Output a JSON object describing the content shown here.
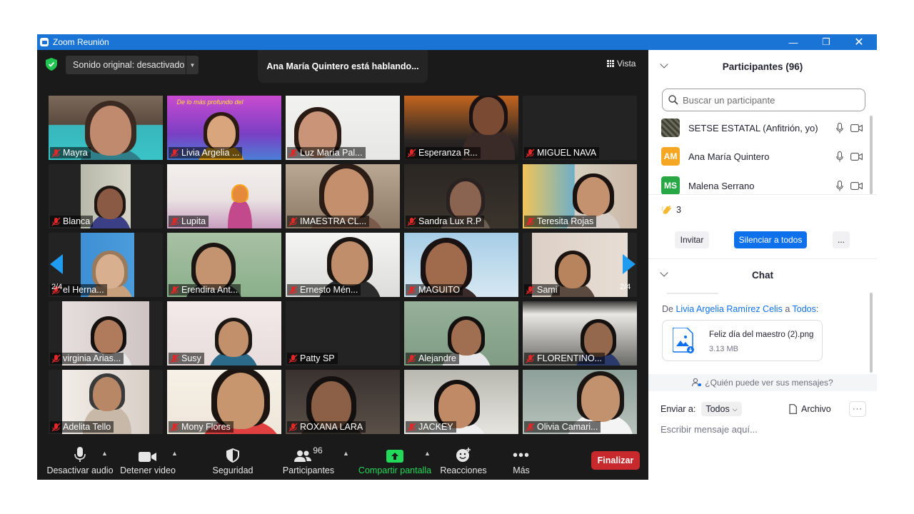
{
  "window": {
    "title": "Zoom Reunión"
  },
  "meeting": {
    "original_sound": "Sonido original: desactivado",
    "speaking": "Ana María Quintero está hablando...",
    "view_label": "Vista",
    "page_left": "2/4",
    "page_right": "2/4",
    "tiles": [
      {
        "name": "Mayra"
      },
      {
        "name": "Livia Argelia ..."
      },
      {
        "name": "Luz María Pal..."
      },
      {
        "name": "Esperanza R..."
      },
      {
        "name": "MIGUEL NAVA"
      },
      {
        "name": "Blanca"
      },
      {
        "name": "Lupita"
      },
      {
        "name": "IMAESTRA CL..."
      },
      {
        "name": "Sandra Lux R.P"
      },
      {
        "name": "Teresita Rojas"
      },
      {
        "name": "el Herna..."
      },
      {
        "name": "Erendira Ant..."
      },
      {
        "name": "Ernesto Mén..."
      },
      {
        "name": "MAGUITO"
      },
      {
        "name": "Sami"
      },
      {
        "name": "virginia Arias..."
      },
      {
        "name": "Susy"
      },
      {
        "name": "Patty SP"
      },
      {
        "name": "Alejandre"
      },
      {
        "name": "FLORENTINO..."
      },
      {
        "name": "Adelita Tello"
      },
      {
        "name": "Mony Flores"
      },
      {
        "name": "ROXANA LARA"
      },
      {
        "name": "JACKEY"
      },
      {
        "name": "Olivia Camari..."
      }
    ],
    "tile_banner": "De lo más profundo del"
  },
  "toolbar": {
    "mute": "Desactivar audio",
    "video": "Detener video",
    "security": "Seguridad",
    "participants": "Participantes",
    "participants_count": "96",
    "share": "Compartir pantalla",
    "reactions": "Reacciones",
    "more": "Más",
    "end": "Finalizar"
  },
  "participants_panel": {
    "title": "Participantes (96)",
    "search_placeholder": "Buscar un participante",
    "list": [
      {
        "name": "SETSE ESTATAL (Anfitrión, yo)",
        "initials": "",
        "color": "#5a5a4a"
      },
      {
        "name": "Ana María Quintero",
        "initials": "AM",
        "color": "#f5a623"
      },
      {
        "name": "Malena Serrano",
        "initials": "MS",
        "color": "#28a745"
      }
    ],
    "clap_count": "3",
    "invite": "Invitar",
    "mute_all": "Silenciar a todos",
    "more": "..."
  },
  "chat": {
    "title": "Chat",
    "from_prefix": "De",
    "from_name": "Livia Argelia Ramírez Celis",
    "to_prefix": "a",
    "to_name": "Todos",
    "file_name": "Feliz día del maestro (2).png",
    "file_size": "3.13 MB",
    "who_sees": "¿Quién puede ver sus mensajes?",
    "send_to_label": "Enviar a:",
    "send_to_value": "Todos",
    "file_button": "Archivo",
    "input_placeholder": "Escribir mensaje aquí..."
  },
  "colors": {
    "title_bar": "#1a74d6",
    "accent_blue": "#0e71eb",
    "end_red": "#c7292d",
    "share_green": "#23d959",
    "mic_off_red": "#e02828"
  }
}
